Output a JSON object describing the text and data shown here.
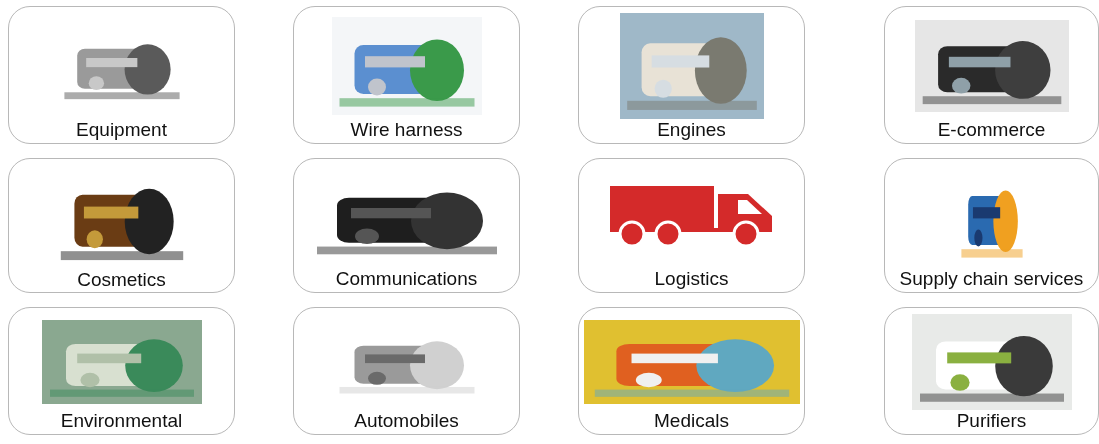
{
  "tiles": [
    {
      "label": "Equipment",
      "kind": "picture"
    },
    {
      "label": "Wire harness",
      "kind": "picture"
    },
    {
      "label": "Engines",
      "kind": "picture"
    },
    {
      "label": "E-commerce",
      "kind": "picture"
    },
    {
      "label": "Cosmetics",
      "kind": "picture"
    },
    {
      "label": "Communications",
      "kind": "picture"
    },
    {
      "label": "Logistics",
      "kind": "truck"
    },
    {
      "label": "Supply chain services",
      "kind": "picture"
    },
    {
      "label": "Environmental",
      "kind": "picture"
    },
    {
      "label": "Automobiles",
      "kind": "picture"
    },
    {
      "label": "Medicals",
      "kind": "picture"
    },
    {
      "label": "Purifiers",
      "kind": "picture"
    }
  ]
}
